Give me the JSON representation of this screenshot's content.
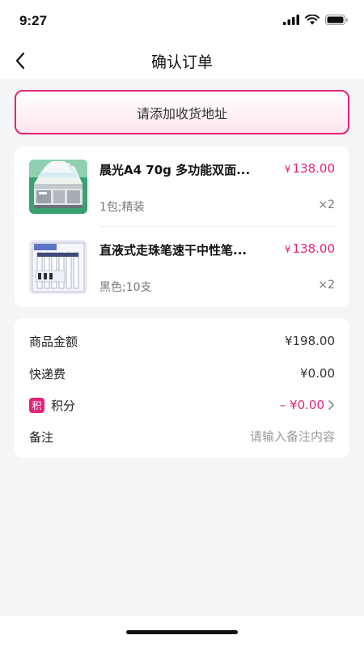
{
  "status_bar": {
    "time": "9:27"
  },
  "nav": {
    "title": "确认订单"
  },
  "address": {
    "placeholder_label": "请添加收货地址"
  },
  "products": [
    {
      "title": "晨光A4 70g 多功能双面...",
      "price_symbol": "¥",
      "price": "138.00",
      "spec": "1包;精装",
      "quantity": "×2",
      "thumb_icon": "paper-box-icon"
    },
    {
      "title": "直液式走珠笔速干中性笔...",
      "price_symbol": "¥",
      "price": "138.00",
      "spec": "黑色;10支",
      "quantity": "×2",
      "thumb_icon": "pen-pack-icon"
    }
  ],
  "summary": {
    "goods_amount_label": "商品金额",
    "goods_amount_value": "¥198.00",
    "shipping_label": "快递费",
    "shipping_value": "¥0.00",
    "points_badge": "积",
    "points_label": "积分",
    "points_value": "– ¥0.00",
    "note_label": "备注",
    "note_placeholder": "请输入备注内容"
  },
  "colors": {
    "accent": "#e4237a",
    "background": "#f5f5f7",
    "card": "#ffffff"
  }
}
